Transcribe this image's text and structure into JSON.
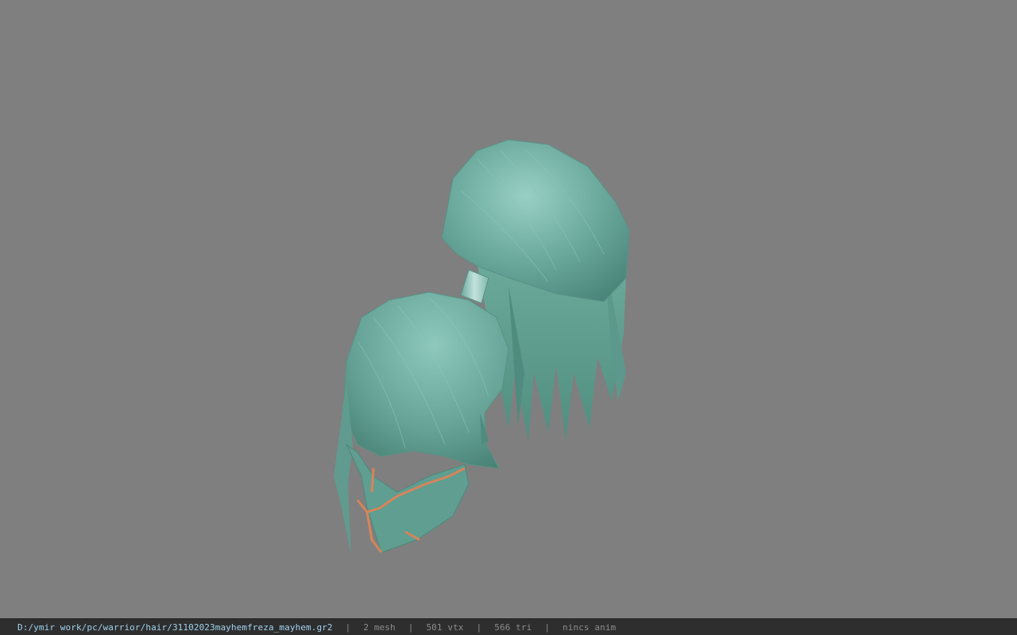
{
  "viewport": {
    "background_color": "#7f7f7f",
    "model_name": "hair model",
    "hair_color": "#6aa89c",
    "band_color": "#a9d4cc",
    "trim_color": "#d8845a"
  },
  "statusbar": {
    "path": "D:/ymir work/pc/warrior/hair/31102023mayhemfreza_mayhem.gr2",
    "separator": "|",
    "mesh": "2 mesh",
    "vtx": "501 vtx",
    "tri": "566 tri",
    "anim": "nincs anim",
    "path_color": "#9fd2ee"
  }
}
